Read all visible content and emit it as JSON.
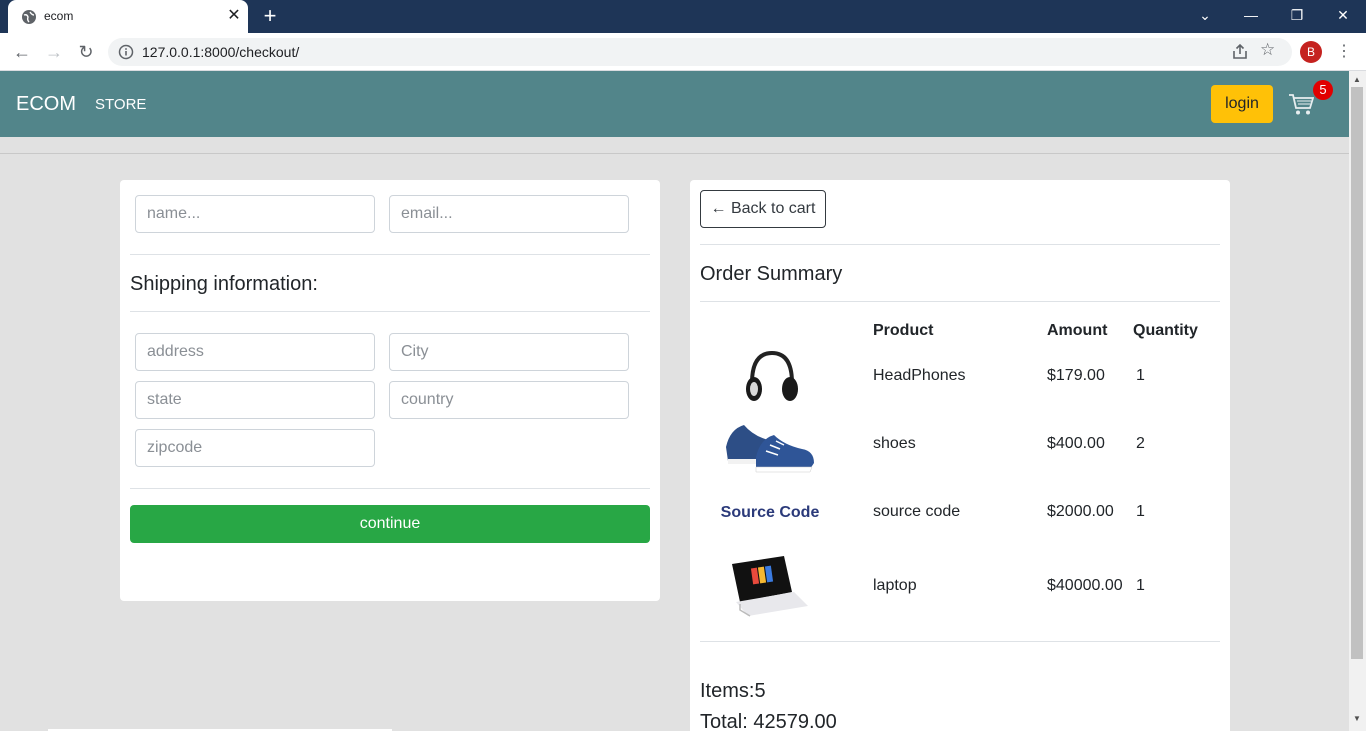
{
  "browser": {
    "tab_title": "ecom",
    "url": "127.0.0.1:8000/checkout/",
    "profile_initial": "B",
    "icons": [
      "globe-icon",
      "close-icon",
      "plus-icon",
      "chevron-down-icon",
      "minimize-icon",
      "restore-icon",
      "window-close-icon",
      "back-arrow-icon",
      "forward-arrow-icon",
      "reload-icon",
      "info-icon",
      "share-icon",
      "star-icon",
      "kebab-menu-icon"
    ]
  },
  "navbar": {
    "brand": "ECOM",
    "store_link": "STORE",
    "login_label": "login",
    "cart_count": "5",
    "colors": {
      "navbar_bg": "#52858a",
      "login_bg": "#ffc107",
      "badge_bg": "#e10000"
    }
  },
  "form": {
    "name_placeholder": "name...",
    "email_placeholder": "email...",
    "shipping_title": "Shipping information:",
    "address_placeholder": "address",
    "city_placeholder": "City",
    "state_placeholder": "state",
    "country_placeholder": "country",
    "zipcode_placeholder": "zipcode",
    "continue_label": "continue",
    "continue_color": "#28a745"
  },
  "summary": {
    "back_label": "← Back to cart",
    "title": "Order Summary",
    "columns": {
      "product": "Product",
      "amount": "Amount",
      "quantity": "Quantity"
    },
    "items": [
      {
        "product": "HeadPhones",
        "amount": "$179.00",
        "quantity": "1",
        "image_icon": "headphones-image"
      },
      {
        "product": "shoes",
        "amount": "$400.00",
        "quantity": "2",
        "image_icon": "shoes-image"
      },
      {
        "product": "source code",
        "amount": "$2000.00",
        "quantity": "1",
        "image_icon": "source-code-image",
        "image_text": "Source Code"
      },
      {
        "product": "laptop",
        "amount": "$40000.00",
        "quantity": "1",
        "image_icon": "laptop-image"
      }
    ],
    "items_total": "Items:5",
    "grand_total": "Total: 42579.00"
  }
}
